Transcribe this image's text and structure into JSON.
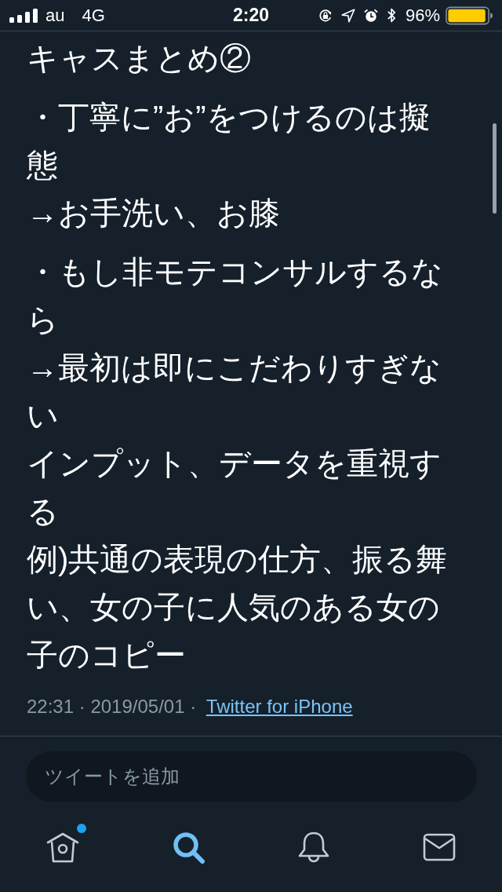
{
  "status_bar": {
    "carrier": "au",
    "network": "4G",
    "time": "2:20",
    "battery_percent": "96%",
    "battery": {
      "level": 0.96,
      "low_power_mode": true
    }
  },
  "tweet": {
    "paragraphs": [
      [
        "キャスまとめ②"
      ],
      [
        "・丁寧に”お”をつけるのは擬態",
        "→お手洗い、お膝"
      ],
      [
        "・もし非モテコンサルするなら",
        "→最初は即にこだわりすぎない",
        "インプット、データを重視する",
        "例)共通の表現の仕方、振る舞い、女の子に人気のある女の子のコピー"
      ]
    ],
    "timestamp": "22:31 · 2019/05/01 ·",
    "source": "Twitter for iPhone"
  },
  "reply_field": {
    "placeholder": "ツイートを追加"
  },
  "tab_bar": [
    {
      "kind": "home",
      "selected": false,
      "badge": true
    },
    {
      "kind": "search",
      "selected": true,
      "badge": false
    },
    {
      "kind": "notifications",
      "selected": false,
      "badge": false
    },
    {
      "kind": "messages",
      "selected": false,
      "badge": false
    }
  ]
}
